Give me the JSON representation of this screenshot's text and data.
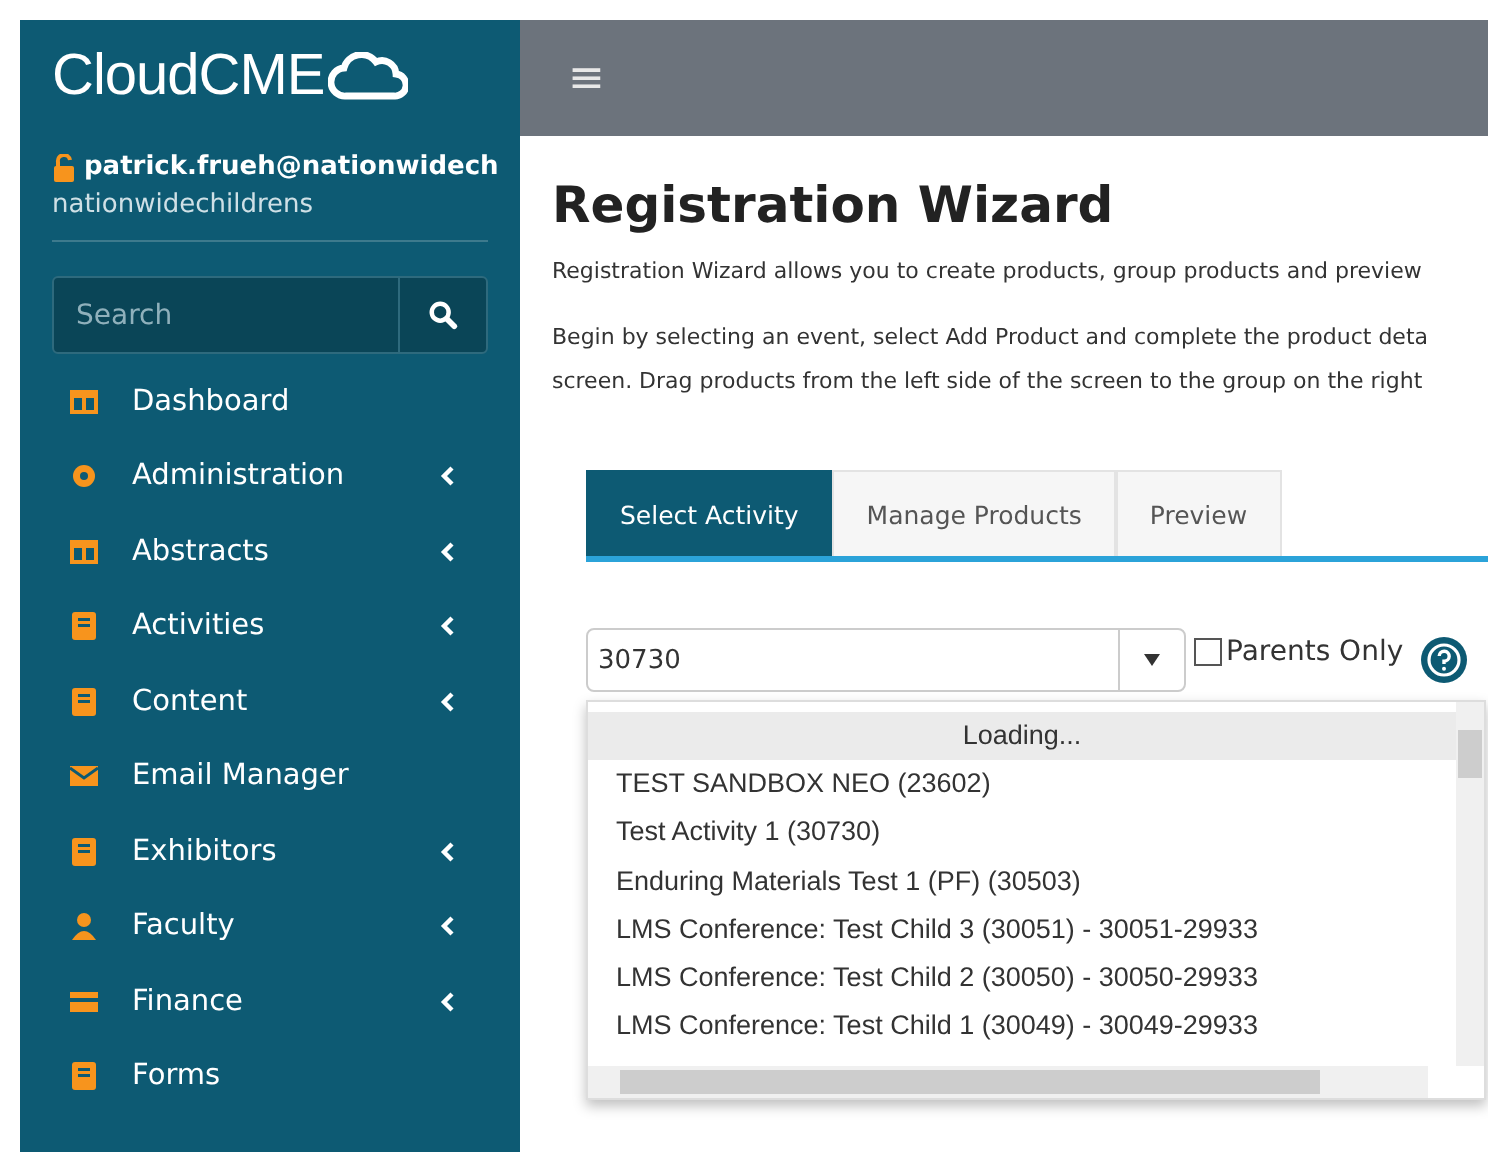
{
  "sidebar": {
    "logo": "CloudCME",
    "user": {
      "email": "patrick.frueh@nationwidech",
      "org": "nationwidechildrens"
    },
    "search": {
      "placeholder": "Search"
    },
    "items": [
      {
        "label": "Dashboard",
        "expandable": false
      },
      {
        "label": "Administration",
        "expandable": true
      },
      {
        "label": "Abstracts",
        "expandable": true
      },
      {
        "label": "Activities",
        "expandable": true
      },
      {
        "label": "Content",
        "expandable": true
      },
      {
        "label": "Email Manager",
        "expandable": false
      },
      {
        "label": "Exhibitors",
        "expandable": true
      },
      {
        "label": "Faculty",
        "expandable": true
      },
      {
        "label": "Finance",
        "expandable": true
      },
      {
        "label": "Forms",
        "expandable": false
      }
    ]
  },
  "topbar": {
    "menu_icon": "≡"
  },
  "page": {
    "title": "Registration Wizard",
    "intro": "Registration Wizard allows you to create products, group products and preview",
    "instructions": [
      "Begin by selecting an event, select Add Product and complete the product deta",
      "screen. Drag products from the left side of the screen to the group on the right"
    ],
    "tabs": [
      {
        "label": "Select Activity",
        "selected": true
      },
      {
        "label": "Manage Products",
        "selected": false
      },
      {
        "label": "Preview",
        "selected": false
      }
    ],
    "activity_select": {
      "value": "30730"
    },
    "parents_only": {
      "label": "Parents Only",
      "checked": false
    },
    "dropdown": {
      "status": "Loading...",
      "options": [
        "TEST SANDBOX NEO (23602)",
        "Test Activity 1 (30730)",
        "Enduring Materials Test 1 (PF) (30503)",
        "LMS Conference: Test Child 3 (30051) - 30051-29933",
        "LMS Conference: Test Child 2 (30050) - 30050-29933",
        "LMS Conference: Test Child 1 (30049) - 30049-29933"
      ]
    }
  }
}
